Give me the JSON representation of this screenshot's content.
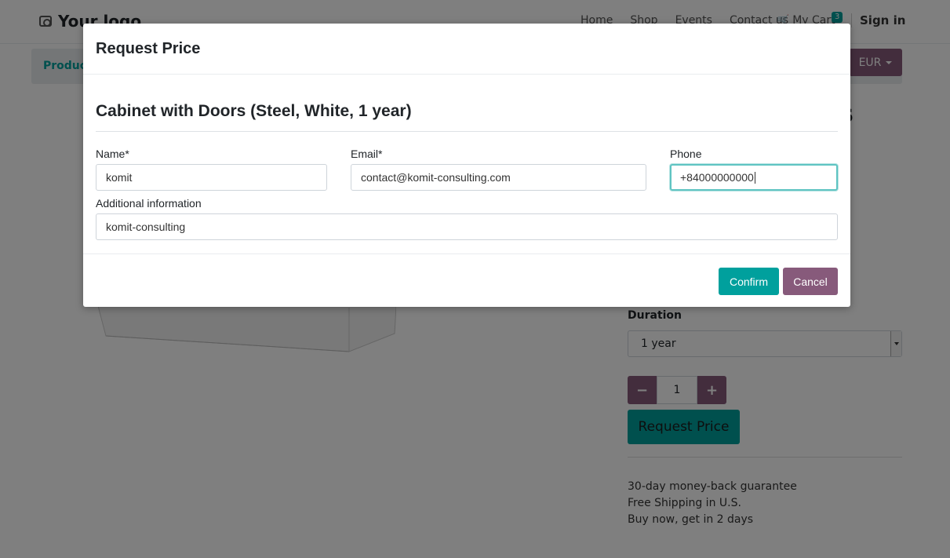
{
  "navbar": {
    "logo_text": "Your logo",
    "links": [
      "Home",
      "Shop",
      "Events",
      "Contact us"
    ],
    "cart_label": "My Cart",
    "cart_count": "3",
    "signin_label": "Sign in"
  },
  "subnav": {
    "products_label": "Product",
    "currency": "EUR"
  },
  "product": {
    "heading_fragment": "s",
    "duration_label": "Duration",
    "duration_value": "1 year",
    "quantity": "1",
    "minus_symbol": "−",
    "plus_symbol": "+",
    "request_price_label": "Request Price",
    "features": [
      "30-day money-back guarantee",
      "Free Shipping in U.S.",
      "Buy now, get in 2 days"
    ]
  },
  "modal": {
    "title": "Request Price",
    "product_name": "Cabinet with Doors (Steel, White, 1 year)",
    "fields": {
      "name_label": "Name*",
      "name_value": "komit",
      "email_label": "Email*",
      "email_value": "contact@komit-consulting.com",
      "phone_label": "Phone",
      "phone_value": "+84000000000",
      "info_label": "Additional information",
      "info_value": "komit-consulting"
    },
    "confirm_label": "Confirm",
    "cancel_label": "Cancel"
  },
  "colors": {
    "primary": "#00A09D",
    "secondary": "#875A7B"
  }
}
